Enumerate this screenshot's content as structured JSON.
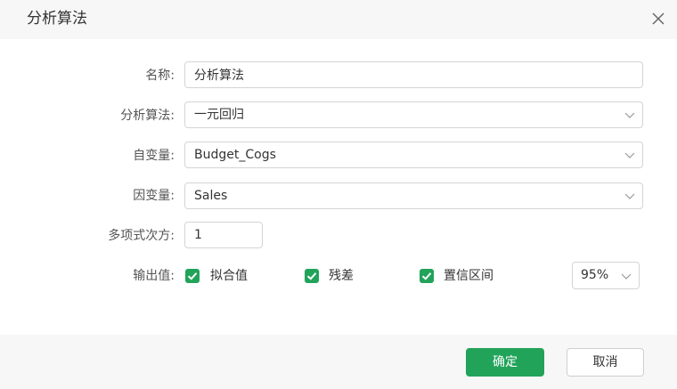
{
  "dialog": {
    "title": "分析算法"
  },
  "form": {
    "name_label": "名称:",
    "name_value": "分析算法",
    "algorithm_label": "分析算法:",
    "algorithm_value": "一元回归",
    "independent_label": "自变量:",
    "independent_value": "Budget_Cogs",
    "dependent_label": "因变量:",
    "dependent_value": "Sales",
    "poly_label": "多项式次方:",
    "poly_value": "1",
    "output_label": "输出值:",
    "outputs": [
      {
        "label": "拟合值",
        "checked": true
      },
      {
        "label": "残差",
        "checked": true
      },
      {
        "label": "置信区间",
        "checked": true
      }
    ],
    "confidence_value": "95%"
  },
  "footer": {
    "ok_label": "确定",
    "cancel_label": "取消"
  },
  "colors": {
    "accent": "#22a35a",
    "header_bg": "#f7f7f7",
    "border": "#d4d4d4"
  },
  "icons": {
    "close": "close-icon",
    "dropdown": "chevron-down-icon",
    "check": "check-icon"
  }
}
